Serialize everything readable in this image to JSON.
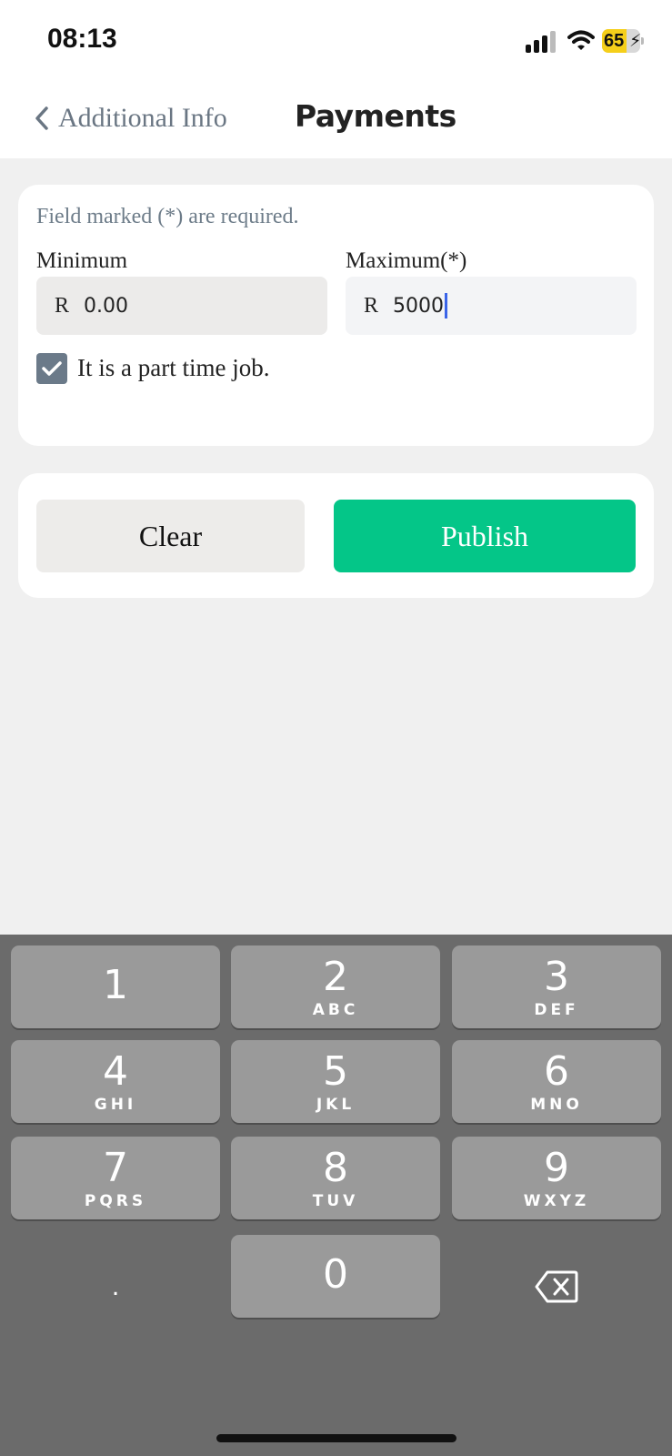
{
  "status_bar": {
    "time": "08:13",
    "battery": "65"
  },
  "nav": {
    "back_label": "Additional Info",
    "title": "Payments"
  },
  "form": {
    "required_note": "Field marked (*) are required.",
    "minimum": {
      "label": "Minimum",
      "currency": "R",
      "value": "0.00"
    },
    "maximum": {
      "label": "Maximum(*)",
      "currency": "R",
      "value": "5000"
    },
    "part_time": {
      "label": "It is a part time job.",
      "checked": true
    }
  },
  "actions": {
    "clear_label": "Clear",
    "publish_label": "Publish"
  },
  "keypad": {
    "keys": [
      {
        "num": "1",
        "letters": ""
      },
      {
        "num": "2",
        "letters": "ABC"
      },
      {
        "num": "3",
        "letters": "DEF"
      },
      {
        "num": "4",
        "letters": "GHI"
      },
      {
        "num": "5",
        "letters": "JKL"
      },
      {
        "num": "6",
        "letters": "MNO"
      },
      {
        "num": "7",
        "letters": "PQRS"
      },
      {
        "num": "8",
        "letters": "TUV"
      },
      {
        "num": "9",
        "letters": "WXYZ"
      },
      {
        "num": "0",
        "letters": ""
      }
    ],
    "decimal": "."
  },
  "colors": {
    "accent": "#04c688",
    "checkbox": "#6b7a89",
    "caret": "#3a64e8"
  }
}
